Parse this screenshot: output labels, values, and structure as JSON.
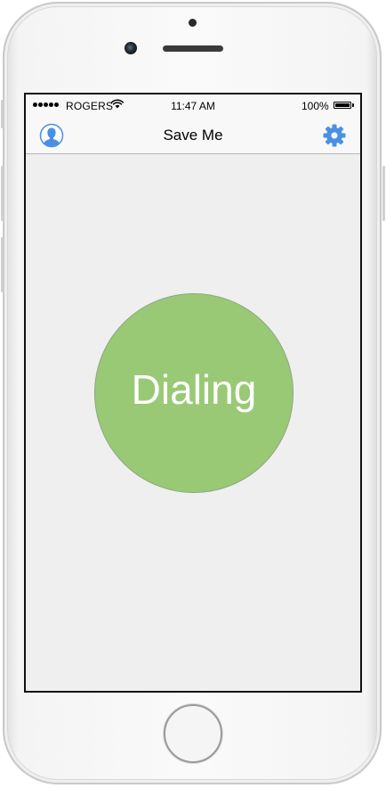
{
  "status_bar": {
    "carrier": "ROGERS",
    "time": "11:47 AM",
    "battery_percent": "100%",
    "battery_level": 1.0,
    "signal_bars": 5
  },
  "nav_bar": {
    "title": "Save Me",
    "left_icon": "person-icon",
    "right_icon": "gear-icon"
  },
  "main": {
    "dial_button_label": "Dialing"
  },
  "colors": {
    "accent": "#4a90e2",
    "dial_circle": "#99c975",
    "screen_background": "#efefef"
  }
}
